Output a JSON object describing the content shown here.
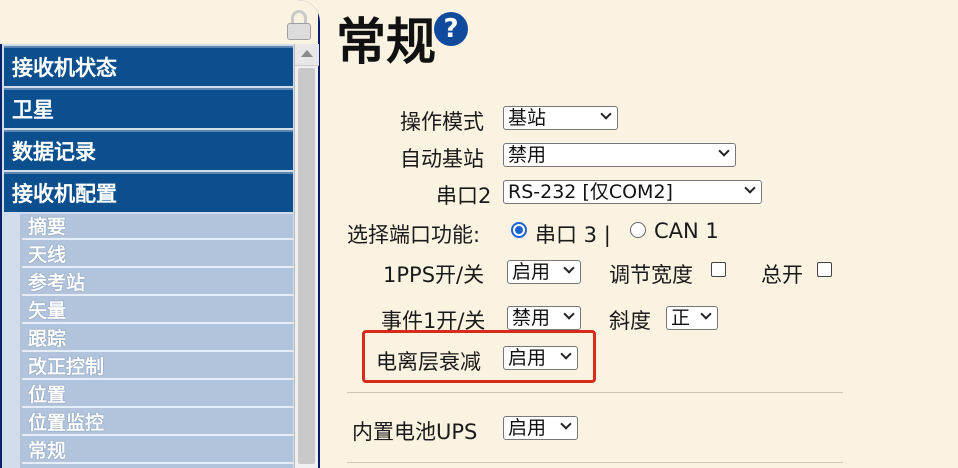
{
  "sidebar": {
    "main_items": [
      {
        "label": "接收机状态"
      },
      {
        "label": "卫星"
      },
      {
        "label": "数据记录"
      },
      {
        "label": "接收机配置"
      }
    ],
    "sub_items": [
      {
        "label": "摘要"
      },
      {
        "label": "天线"
      },
      {
        "label": "参考站"
      },
      {
        "label": "矢量"
      },
      {
        "label": "跟踪"
      },
      {
        "label": "改正控制"
      },
      {
        "label": "位置"
      },
      {
        "label": "位置监控"
      },
      {
        "label": "常规"
      }
    ]
  },
  "page": {
    "title": "常规",
    "help_glyph": "?"
  },
  "form": {
    "operation_mode": {
      "label": "操作模式",
      "value": "基站"
    },
    "auto_base": {
      "label": "自动基站",
      "value": "禁用"
    },
    "serial2": {
      "label": "串口2",
      "value": "RS-232 [仅COM2]"
    },
    "port_function": {
      "label": "选择端口功能:",
      "option1": "串口 3 |",
      "option2": "CAN 1",
      "selected": "串口 3"
    },
    "pps": {
      "label": "1PPS开/关",
      "value": "启用",
      "adjust_width_label": "调节宽度",
      "master_label": "总开"
    },
    "event1": {
      "label": "事件1开/关",
      "value": "禁用",
      "slope_label": "斜度",
      "slope_value": "正"
    },
    "iono": {
      "label": "电离层衰减",
      "value": "启用"
    },
    "battery_ups": {
      "label": "内置电池UPS",
      "value": "启用"
    }
  },
  "colors": {
    "nav_main_bg": "#0b4f8f",
    "nav_sub_bg": "#b2c4dc",
    "page_bg": "#fbf3e1",
    "highlight": "#d92b1c",
    "radio_accent": "#1a63d6"
  }
}
